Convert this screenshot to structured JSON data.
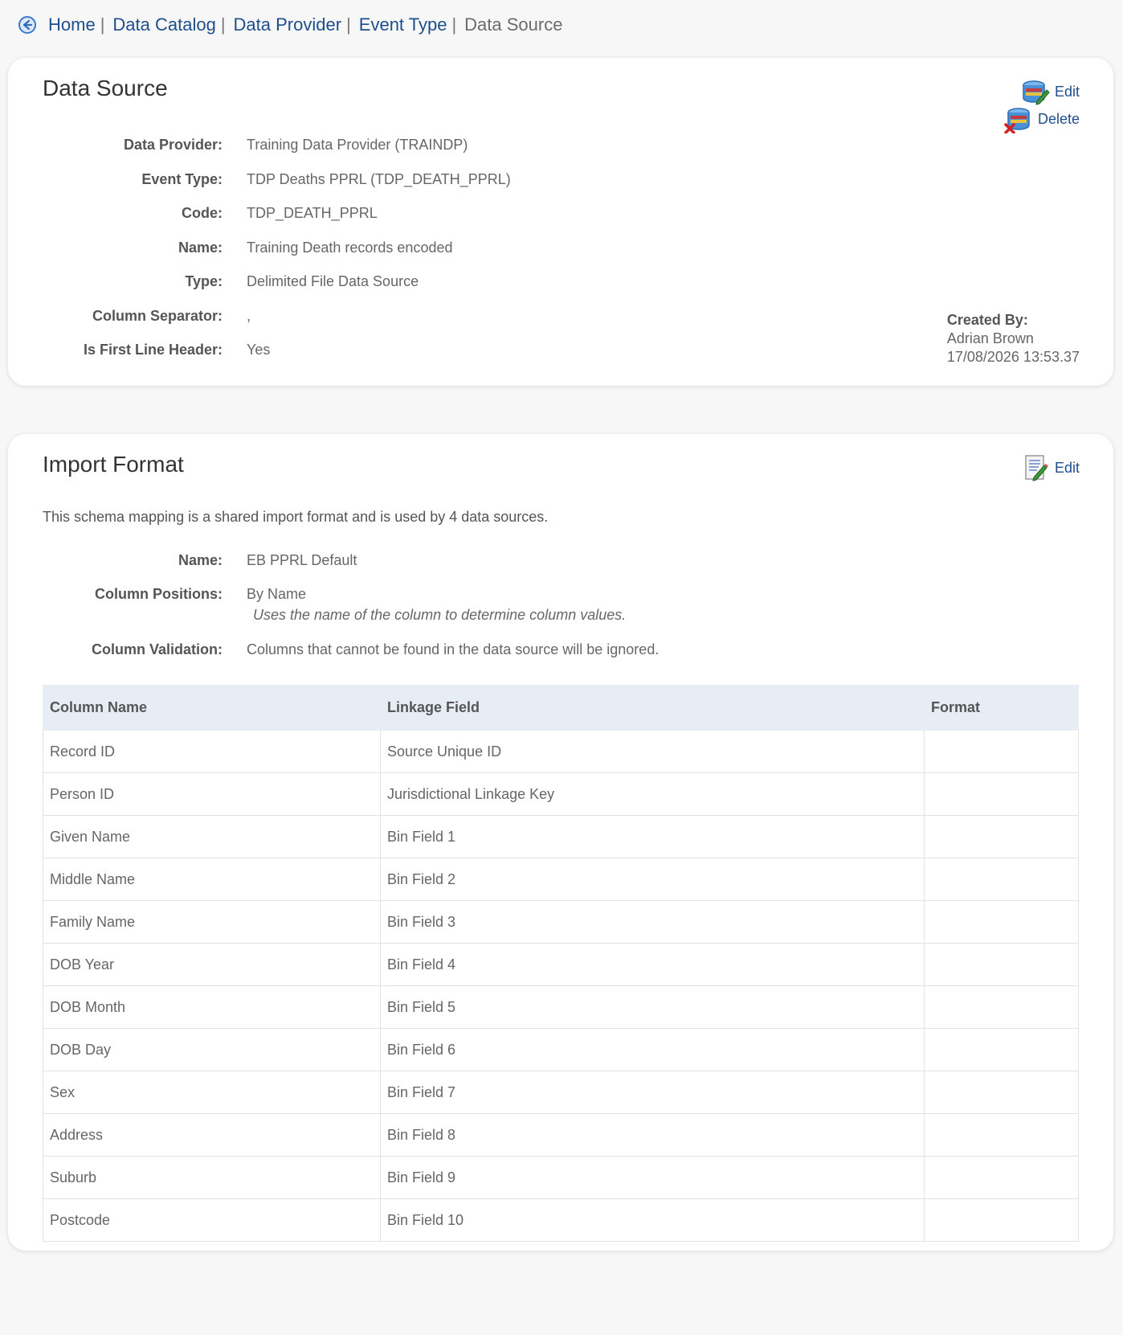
{
  "breadcrumb": {
    "items": [
      "Home",
      "Data Catalog",
      "Data Provider",
      "Event Type"
    ],
    "separator": "|",
    "current": "Data Source"
  },
  "data_source": {
    "title": "Data Source",
    "edit_label": "Edit",
    "delete_label": "Delete",
    "fields": [
      {
        "label": "Data Provider:",
        "value": "Training Data Provider (TRAINDP)"
      },
      {
        "label": "Event Type:",
        "value": "TDP Deaths PPRL (TDP_DEATH_PPRL)"
      },
      {
        "label": "Code:",
        "value": "TDP_DEATH_PPRL"
      },
      {
        "label": "Name:",
        "value": "Training Death records encoded"
      },
      {
        "label": "Type:",
        "value": "Delimited File Data Source"
      },
      {
        "label": "Column Separator:",
        "value": ","
      },
      {
        "label": "Is First Line Header:",
        "value": "Yes"
      }
    ],
    "created_by_label": "Created By:",
    "created_by_name": "Adrian Brown",
    "created_at": "17/08/2026 13:53.37"
  },
  "import_format": {
    "title": "Import Format",
    "edit_label": "Edit",
    "description": "This schema mapping is a shared import format and is used by 4 data sources.",
    "name_label": "Name:",
    "name_value": "EB PPRL Default",
    "positions_label": "Column Positions:",
    "positions_value": "By Name",
    "positions_note": "Uses the name of the column to determine column values.",
    "validation_label": "Column Validation:",
    "validation_value": "Columns that cannot be found in the data source will be ignored.",
    "table": {
      "headers": [
        "Column Name",
        "Linkage Field",
        "Format"
      ],
      "rows": [
        [
          "Record ID",
          "Source Unique ID",
          ""
        ],
        [
          "Person ID",
          "Jurisdictional Linkage Key",
          ""
        ],
        [
          "Given Name",
          "Bin Field 1",
          ""
        ],
        [
          "Middle Name",
          "Bin Field 2",
          ""
        ],
        [
          "Family Name",
          "Bin Field 3",
          ""
        ],
        [
          "DOB Year",
          "Bin Field 4",
          ""
        ],
        [
          "DOB Month",
          "Bin Field 5",
          ""
        ],
        [
          "DOB Day",
          "Bin Field 6",
          ""
        ],
        [
          "Sex",
          "Bin Field 7",
          ""
        ],
        [
          "Address",
          "Bin Field 8",
          ""
        ],
        [
          "Suburb",
          "Bin Field 9",
          ""
        ],
        [
          "Postcode",
          "Bin Field 10",
          ""
        ]
      ]
    }
  },
  "icons": {
    "back": "back-arrow-icon",
    "edit": "database-edit-icon",
    "delete": "database-delete-icon",
    "format_edit": "document-edit-icon"
  },
  "colors": {
    "link": "#1f4e8c",
    "table_header_bg": "#e7edf5"
  }
}
